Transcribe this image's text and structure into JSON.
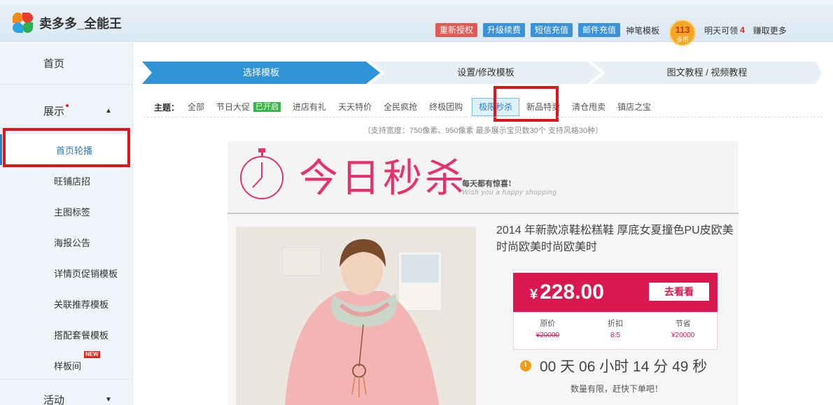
{
  "header": {
    "app_name": "卖多多_全能王",
    "buttons": [
      {
        "label": "重新授权",
        "style": "red"
      },
      {
        "label": "升级续费",
        "style": "blue"
      },
      {
        "label": "短信充值",
        "style": "blue"
      },
      {
        "label": "邮件充值",
        "style": "blue"
      }
    ],
    "link_template": "神笔模板",
    "coin_count": "113",
    "coin_unit": "多币",
    "tomorrow_label": "明天可领",
    "tomorrow_count": "4",
    "earn_more": "赚取更多"
  },
  "sidebar": {
    "home": "首页",
    "display": "展示",
    "display_arrow": "▲",
    "items": [
      {
        "label": "首页轮播"
      },
      {
        "label": "旺铺店招"
      },
      {
        "label": "主图标签"
      },
      {
        "label": "海报公告"
      },
      {
        "label": "详情页促销模板"
      },
      {
        "label": "关联推荐模板"
      },
      {
        "label": "搭配套餐模板"
      },
      {
        "label": "样板间"
      }
    ],
    "new_badge": "NEW",
    "activity": "活动",
    "activity_arrow": "▼"
  },
  "steps": [
    "选择模板",
    "设置/修改模板",
    "图文教程 / 视频教程"
  ],
  "themes": {
    "label": "主题：",
    "items": [
      "全部",
      "节日大促",
      "进店有礼",
      "天天特价",
      "全民疯抢",
      "终极团购",
      "极限秒杀",
      "新品特卖",
      "清仓甩卖",
      "镇店之宝"
    ],
    "festival_badge": "已开启",
    "selected": "极限秒杀"
  },
  "hint": "（支持宽度：750像素、950像素 最多展示宝贝数30个 支持风格30种）",
  "preview": {
    "title": "今日秒杀",
    "sub_cn": "每天都有惊喜!",
    "sub_en": "Wish you a happy shopping",
    "product_title": "2014 年新款凉鞋松糕鞋 厚底女夏撞色PU皮欧美时尚欧美时尚欧美时",
    "currency": "¥",
    "price": "228.00",
    "go_button": "去看看",
    "info": [
      {
        "key": "原价",
        "value": "¥20000"
      },
      {
        "key": "折扣",
        "value": "8.5"
      },
      {
        "key": "节省",
        "value": "¥20000"
      }
    ],
    "countdown": "00 天 06 小时 14 分 49 秒",
    "limited": "数量有限，赶快下单吧！"
  },
  "colors": {
    "accent": "#3093d6",
    "highlight_red": "#e0141a",
    "sale_pink": "#d8184f"
  }
}
